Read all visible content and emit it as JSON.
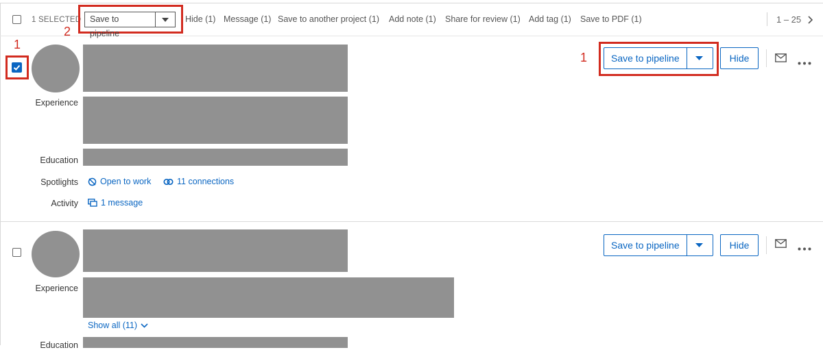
{
  "toolbar": {
    "selected_label": "1 SELECTED",
    "save_to_pipeline": "Save to pipeline",
    "actions": [
      "Hide (1)",
      "Message (1)",
      "Save to another project (1)",
      "Add note (1)",
      "Share for review (1)",
      "Add tag (1)",
      "Save to PDF (1)"
    ],
    "pager": "1 – 25"
  },
  "annotations": {
    "one": "1",
    "two": "2"
  },
  "cards": [
    {
      "checked": true,
      "labels": {
        "experience": "Experience",
        "education": "Education",
        "spotlights": "Spotlights",
        "activity": "Activity"
      },
      "spotlights": [
        "Open to work",
        "11 connections"
      ],
      "activity": "1 message",
      "save_to_pipeline": "Save to pipeline",
      "hide": "Hide"
    },
    {
      "checked": false,
      "labels": {
        "experience": "Experience",
        "education": "Education"
      },
      "show_all": "Show all (11)",
      "save_to_pipeline": "Save to pipeline",
      "hide": "Hide"
    }
  ],
  "colors": {
    "accent": "#0a66c2",
    "annotation": "#d22b1f",
    "placeholder": "#919191"
  }
}
